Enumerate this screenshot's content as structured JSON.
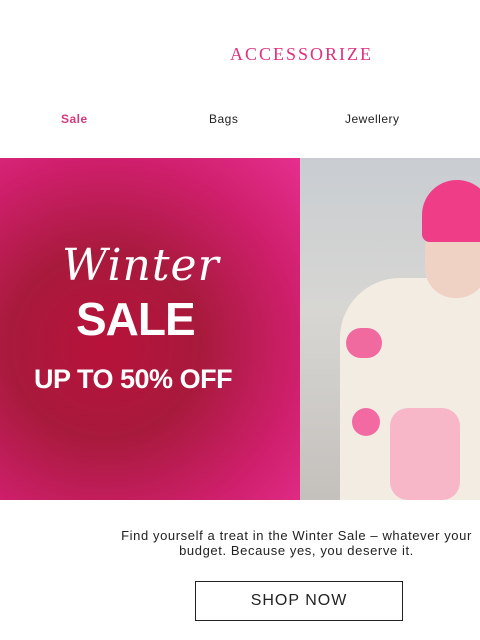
{
  "header": {
    "logo_text": "ACCESSORIZE"
  },
  "nav": {
    "items": [
      {
        "label": "Sale"
      },
      {
        "label": "Bags"
      },
      {
        "label": "Jewellery"
      }
    ]
  },
  "hero": {
    "script_title": "Winter",
    "headline": "SALE",
    "offer": "UP TO 50% OFF"
  },
  "promo": {
    "body": "Find yourself a treat in the Winter Sale – whatever your budget. Because yes, you deserve it.",
    "cta_label": "SHOP NOW"
  }
}
